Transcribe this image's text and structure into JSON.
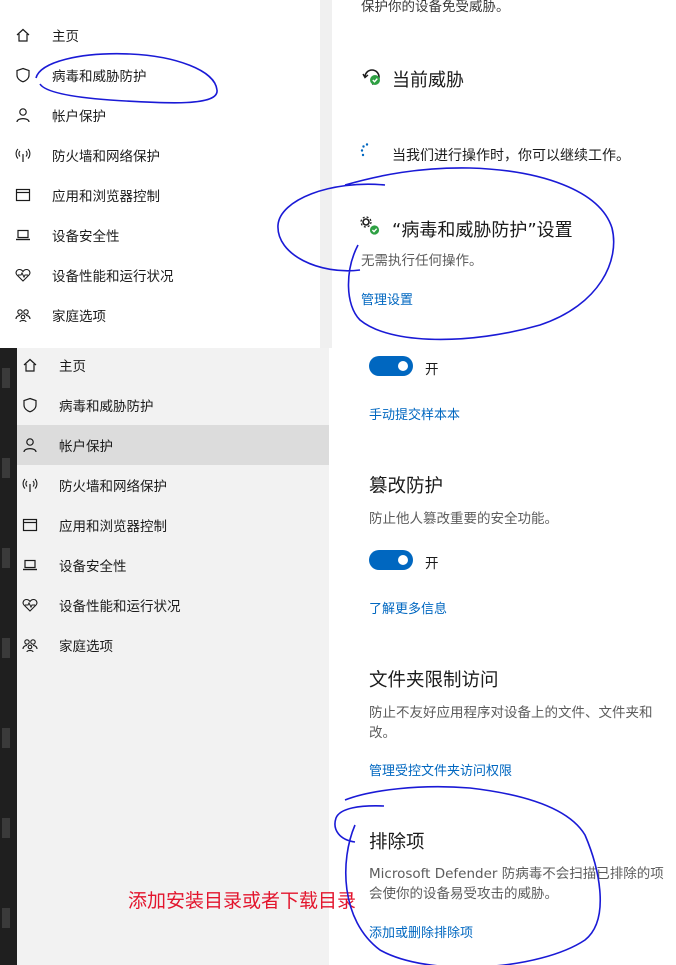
{
  "top_partial_text": "保护你的设备免受威胁。",
  "nav_top": [
    {
      "label": "主页",
      "icon": "home-icon"
    },
    {
      "label": "病毒和威胁防护",
      "icon": "shield-icon"
    },
    {
      "label": "帐户保护",
      "icon": "person-icon"
    },
    {
      "label": "防火墙和网络保护",
      "icon": "wifi-antenna-icon"
    },
    {
      "label": "应用和浏览器控制",
      "icon": "browser-window-icon"
    },
    {
      "label": "设备安全性",
      "icon": "laptop-icon"
    },
    {
      "label": "设备性能和运行状况",
      "icon": "heart-pulse-icon"
    },
    {
      "label": "家庭选项",
      "icon": "family-icon"
    }
  ],
  "nav_bottom": [
    {
      "label": "主页",
      "icon": "home-icon"
    },
    {
      "label": "病毒和威胁防护",
      "icon": "shield-icon"
    },
    {
      "label": "帐户保护",
      "icon": "person-icon",
      "selected": true
    },
    {
      "label": "防火墙和网络保护",
      "icon": "wifi-antenna-icon"
    },
    {
      "label": "应用和浏览器控制",
      "icon": "browser-window-icon"
    },
    {
      "label": "设备安全性",
      "icon": "laptop-icon"
    },
    {
      "label": "设备性能和运行状况",
      "icon": "heart-pulse-icon"
    },
    {
      "label": "家庭选项",
      "icon": "family-icon"
    }
  ],
  "current_threats": {
    "title": "当前威胁",
    "icon": "refresh-check-icon",
    "working_text": "当我们进行操作时，你可以继续工作。",
    "spinner_icon": "loading-spinner-icon"
  },
  "virus_settings": {
    "title": "“病毒和威胁防护”设置",
    "icon": "gears-check-icon",
    "desc": "无需执行任何操作。",
    "link": "管理设置"
  },
  "sample_submit": {
    "toggle_label": "开",
    "link": "手动提交样本本"
  },
  "tamper": {
    "title": "篡改防护",
    "desc": "防止他人篡改重要的安全功能。",
    "toggle_label": "开",
    "link": "了解更多信息"
  },
  "folder_access": {
    "title": "文件夹限制访问",
    "desc_line1": "防止不友好应用程序对设备上的文件、文件夹和",
    "desc_line2": "改。",
    "link": "管理受控文件夹访问权限"
  },
  "exclusions": {
    "title": "排除项",
    "desc_line1": "Microsoft Defender 防病毒不会扫描已排除的项",
    "desc_line2": "会使你的设备易受攻击的威胁。",
    "link": "添加或删除排除项"
  },
  "annotation": "添加安装目录或者下载目录",
  "colors": {
    "accent": "#0067c0",
    "annotation_red": "#e3152d",
    "ink_blue": "#1a1ad6",
    "status_green": "#2ea043"
  }
}
